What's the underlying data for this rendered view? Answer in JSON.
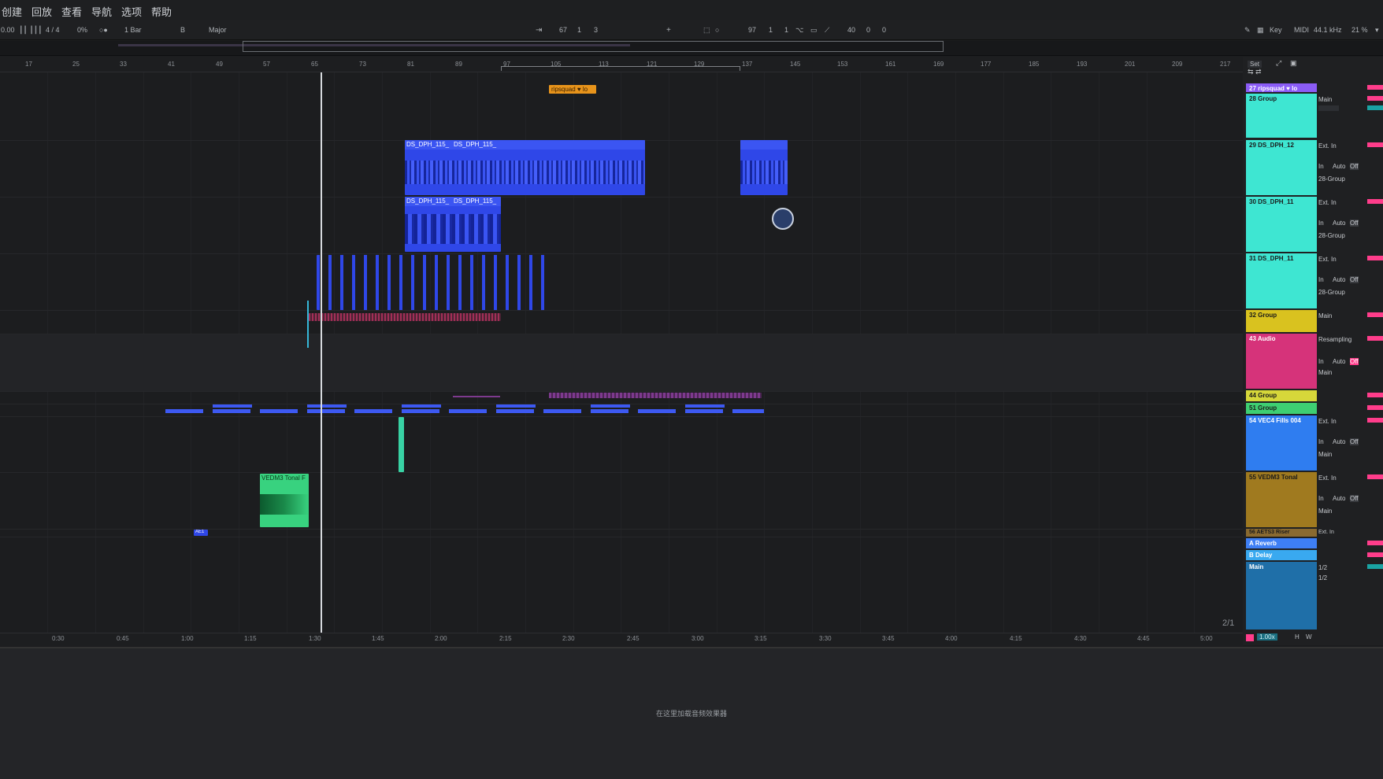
{
  "menu": [
    "创建",
    "回放",
    "查看",
    "导航",
    "选项",
    "帮助"
  ],
  "control_bar": {
    "tempo": "0.00",
    "signature": "4 / 4",
    "groove": "0%",
    "quantize": "1 Bar",
    "key": "B",
    "scale": "Major",
    "position": [
      "67",
      "1",
      "3"
    ],
    "loop_start": [
      "97",
      "1",
      "1"
    ],
    "loop_length": [
      "40",
      "0",
      "0"
    ],
    "key_label": "Key",
    "midi_label": "MIDI",
    "sample_rate": "44.1 kHz",
    "cpu": "21 %"
  },
  "ruler_bars": [
    "17",
    "25",
    "33",
    "41",
    "49",
    "57",
    "65",
    "73",
    "81",
    "89",
    "97",
    "105",
    "113",
    "121",
    "129",
    "137",
    "145",
    "153",
    "161",
    "169",
    "177",
    "185",
    "193",
    "201",
    "209",
    "217"
  ],
  "time_labels": [
    "0:30",
    "0:45",
    "1:00",
    "1:15",
    "1:30",
    "1:45",
    "2:00",
    "2:15",
    "2:30",
    "2:45",
    "3:00",
    "3:15",
    "3:30",
    "3:45",
    "4:00",
    "4:15",
    "4:30",
    "4:45",
    "5:00"
  ],
  "locator": "ripsquad ♥ lo",
  "set_button": "Set",
  "page_indicator": "2/1",
  "clips": {
    "ds1": "DS_DPH_115_",
    "ds2": "DS_DPH_115_",
    "ds3": "DS_DPH_115_",
    "ds4": "DS_DPH_115_",
    "vedm": "VEDM3 Tonal F",
    "small": "AE1"
  },
  "tracks": [
    {
      "title": "27 ripsquad ♥ lo",
      "color": "#8b5cf6"
    },
    {
      "title": "28 Group",
      "color": "#3ee6d2",
      "out": "Main"
    },
    {
      "title": "29 DS_DPH_12",
      "color": "#3ee6d2",
      "in": "Ext. In",
      "route": "28-Group"
    },
    {
      "title": "30 DS_DPH_11",
      "color": "#3ee6d2",
      "in": "Ext. In",
      "route": "28-Group"
    },
    {
      "title": "31 DS_DPH_11",
      "color": "#3ee6d2",
      "in": "Ext. In",
      "route": "28-Group"
    },
    {
      "title": "32 Group",
      "color": "#d9c21f",
      "out": "Main"
    },
    {
      "title": "43 Audio",
      "color": "#d6337a",
      "in": "Resampling",
      "out": "Main"
    },
    {
      "title": "44 Group",
      "color": "#d6d73a"
    },
    {
      "title": "51 Group",
      "color": "#3ecf72"
    },
    {
      "title": "54 VEC4 Fills 004",
      "color": "#2f7df0",
      "in": "Ext. In",
      "out": "Main"
    },
    {
      "title": "55 VEDM3 Tonal",
      "color": "#a07a1f",
      "in": "Ext. In",
      "out": "Main"
    },
    {
      "title": "56 AETS3 Riser",
      "color": "#8a6a30",
      "in": "Ext. In"
    },
    {
      "title": "A Reverb",
      "color": "#3e7ff5"
    },
    {
      "title": "B Delay",
      "color": "#39a9f0"
    },
    {
      "title": "Main",
      "color": "#1f6fa8",
      "sends": [
        "1/2",
        "1/2"
      ]
    }
  ],
  "labels": {
    "in": "In",
    "auto": "Auto",
    "off": "Off",
    "h": "H",
    "w": "W",
    "zoom": "1.00x"
  },
  "device_hint": "在这里加载音频效果器",
  "colors": {
    "clip_blue": "#2f47e8",
    "clip_green": "#38d27f",
    "locator_orange": "#e8941b",
    "accent_pink": "#ff3d8b",
    "teal_meter": "#1aa3a3"
  }
}
